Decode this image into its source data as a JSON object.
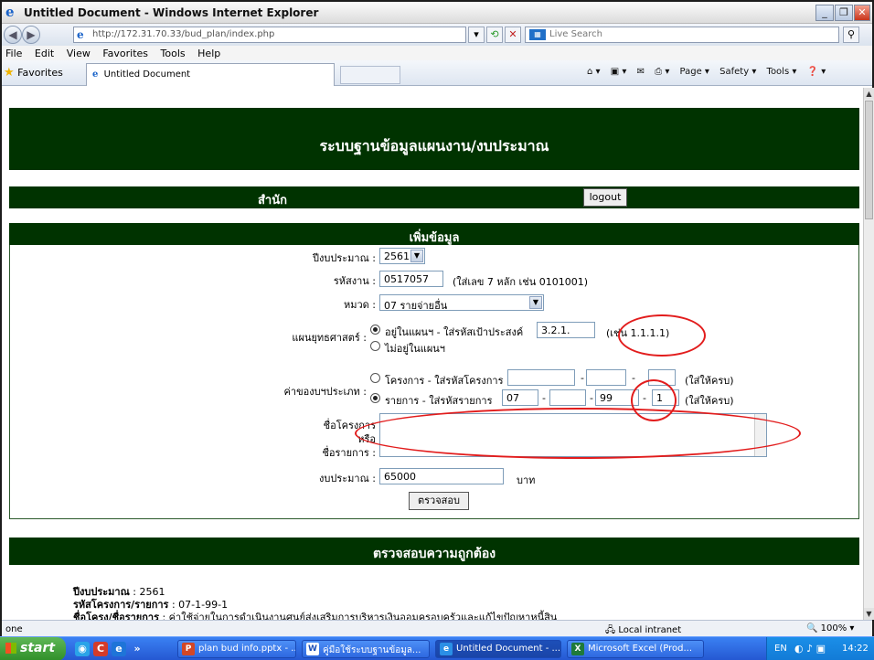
{
  "window": {
    "title": "Untitled Document - Windows Internet Explorer"
  },
  "address": {
    "url": "http://172.31.70.33/bud_plan/index.php",
    "search_placeholder": "Live Search"
  },
  "menu": [
    "File",
    "Edit",
    "View",
    "Favorites",
    "Tools",
    "Help"
  ],
  "favorites": {
    "label": "Favorites",
    "tab_title": "Untitled Document"
  },
  "commandbar": {
    "page": "Page ▾",
    "safety": "Safety ▾",
    "tools": "Tools ▾"
  },
  "page": {
    "banner": "ระบบฐานข้อมูลแผนงาน/งบประมาณ",
    "office_label": "สำนัก",
    "logout": "logout",
    "form_title": "เพิ่มข้อมูล",
    "fiscal_year": {
      "label": "ปีงบประมาณ :",
      "value": "2561"
    },
    "work_code": {
      "label": "รหัสงาน :",
      "value": "0517057",
      "hint": "(ใส่เลข 7 หลัก เช่น 0101001)"
    },
    "category": {
      "label": "หมวด :",
      "value": "07 รายจ่ายอื่น"
    },
    "strategy": {
      "label": "แผนยุทธศาสตร์ :",
      "option_in": "อยู่ในแผนฯ - ใส่รหัสเป้าประสงค์",
      "goal_code": "3.2.1.",
      "example": "(เช่น 1.1.1.1)",
      "option_out": "ไม่อยู่ในแผนฯ"
    },
    "expense_type": {
      "label": "ค่าของบฯประเภท :",
      "option_project": "โครงการ - ใส่รหัสโครงการ",
      "option_item": "รายการ - ใส่รหัสรายการ",
      "item_codes": [
        "07",
        "",
        "99",
        "1"
      ],
      "dash": "-",
      "complete_hint": "(ใส่ให้ครบ)"
    },
    "name_label": {
      "line1": "ชื่อโครงการ",
      "line2": "หรือ",
      "line3": "ชื่อรายการ :"
    },
    "budget": {
      "label": "งบประมาณ :",
      "value": "65000",
      "unit": "บาท"
    },
    "check_button": "ตรวจสอบ",
    "verify_title": "ตรวจสอบความถูกต้อง",
    "result": {
      "fiscal_label": "ปีงบประมาณ",
      "fiscal_value": ": 2561",
      "code_label": "รหัสโครงการ/รายการ",
      "code_value": ": 07-1-99-1",
      "name_label": "ชื่อโครง/ชื่อรายการ",
      "name_value": ": ค่าใช้จ่ายในการดำเนินงานศูนย์ส่งเสริมการบริหารเงินออมครอบครัวและแก้ไขปัญหาหนี้สิน"
    }
  },
  "status": {
    "left": "one",
    "zone": "Local intranet",
    "zoom": "100%"
  },
  "taskbar": {
    "start": "start",
    "items": [
      "plan bud info.pptx - ...",
      "คู่มือใช้ระบบฐานข้อมูล...",
      "Untitled Document - ...",
      "Microsoft Excel (Prod..."
    ],
    "lang": "EN",
    "clock": "14:22"
  },
  "colors": {
    "header_green": "#003300",
    "annotation_red": "#e21c1c"
  }
}
